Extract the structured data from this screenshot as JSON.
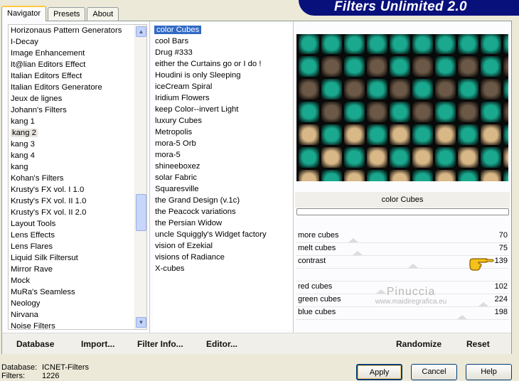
{
  "tabs": [
    "Navigator",
    "Presets",
    "About"
  ],
  "banner_title": "Filters Unlimited 2.0",
  "categories": [
    "Horizonaus Pattern Generators",
    "I-Decay",
    "Image Enhancement",
    "It@lian Editors Effect",
    "Italian Editors Effect",
    "Italian Editors Generatore",
    "Jeux de lignes",
    "Johann's Filters",
    "kang 1",
    "kang 2",
    "kang 3",
    "kang 4",
    "kang",
    "Kohan's Filters",
    "Krusty's FX vol. I 1.0",
    "Krusty's FX vol. II 1.0",
    "Krusty's FX vol. II 2.0",
    "Layout Tools",
    "Lens Effects",
    "Lens Flares",
    "Liquid Silk Filtersut",
    "Mirror Rave",
    "Mock",
    "MuRa's Seamless",
    "Neology",
    "Nirvana",
    "Noise Filters"
  ],
  "selected_category_index": 9,
  "filters": [
    "color Cubes",
    "cool Bars",
    "Drug #333",
    "either the Curtains go or I do !",
    "Houdini is only Sleeping",
    "iceCream Spiral",
    "Iridium Flowers",
    "keep Color--invert Light",
    "luxury Cubes",
    "Metropolis",
    "mora-5 Orb",
    "mora-5",
    "shineeboxez",
    "solar Fabric",
    "Squaresville",
    "the Grand Design     (v.1c)",
    "the Peacock variations",
    "the Persian Widow",
    "uncle Squiggly's Widget factory",
    "vision of Ezekial",
    "visions of Radiance",
    "X-cubes"
  ],
  "selected_filter_index": 0,
  "preview_colors": {
    "teal": "#1aa98f",
    "brown": "#6b5846",
    "gold": "#d9b887",
    "cream": "#f2d8a6"
  },
  "preview_grid": [
    [
      "teal",
      "teal",
      "teal",
      "teal",
      "teal",
      "teal",
      "teal",
      "teal",
      "teal",
      "teal"
    ],
    [
      "teal",
      "brown",
      "teal",
      "brown",
      "teal",
      "brown",
      "teal",
      "brown",
      "teal",
      "brown"
    ],
    [
      "brown",
      "teal",
      "brown",
      "teal",
      "brown",
      "teal",
      "brown",
      "teal",
      "brown",
      "teal"
    ],
    [
      "teal",
      "brown",
      "teal",
      "brown",
      "teal",
      "brown",
      "teal",
      "brown",
      "teal",
      "brown"
    ],
    [
      "gold",
      "teal",
      "gold",
      "teal",
      "gold",
      "teal",
      "gold",
      "teal",
      "gold",
      "teal"
    ],
    [
      "teal",
      "gold",
      "teal",
      "gold",
      "teal",
      "gold",
      "teal",
      "gold",
      "teal",
      "gold"
    ],
    [
      "gold",
      "teal",
      "gold",
      "teal",
      "gold",
      "teal",
      "gold",
      "teal",
      "gold",
      "teal"
    ]
  ],
  "filter_name": "color Cubes",
  "sliders": [
    {
      "label": "more cubes",
      "value": "70",
      "fraction": 0.27
    },
    {
      "label": "melt cubes",
      "value": "75",
      "fraction": 0.29
    },
    {
      "label": "contrast",
      "value": "139",
      "fraction": 0.55
    },
    {
      "label": "",
      "value": "",
      "fraction": null
    },
    {
      "label": "red cubes",
      "value": "102",
      "fraction": 0.4
    },
    {
      "label": "green cubes",
      "value": "224",
      "fraction": 0.88
    },
    {
      "label": "blue cubes",
      "value": "198",
      "fraction": 0.78
    }
  ],
  "watermark": {
    "line1": "Pinuccia",
    "line2": "www.maidiregrafica.eu"
  },
  "bottom_links": {
    "database": "Database",
    "import": "Import...",
    "filter_info": "Filter Info...",
    "editor": "Editor...",
    "randomize": "Randomize",
    "reset": "Reset"
  },
  "status": {
    "database_label": "Database:",
    "database_value": "ICNET-Filters",
    "filters_label": "Filters:",
    "filters_value": "1226"
  },
  "buttons": {
    "apply": "Apply",
    "cancel": "Cancel",
    "help": "Help"
  }
}
